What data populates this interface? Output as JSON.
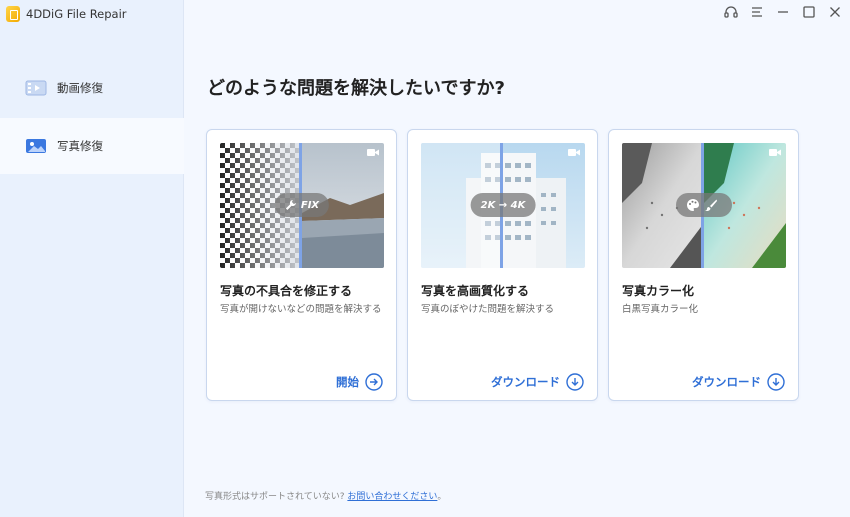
{
  "app": {
    "title": "4DDiG File Repair"
  },
  "sidebar": {
    "items": [
      {
        "label": "動画修復",
        "icon": "video-icon"
      },
      {
        "label": "写真修復",
        "icon": "image-icon",
        "active": true
      }
    ]
  },
  "window_controls": [
    "headset-icon",
    "menu-icon",
    "minimize-icon",
    "maximize-icon",
    "close-icon"
  ],
  "main": {
    "heading": "どのような問題を解決したいですか?",
    "cards": [
      {
        "title": "写真の不具合を修正する",
        "description": "写真が開けないなどの問題を解決する",
        "badge": "FIX",
        "action": "開始",
        "action_icon": "arrow-right-circle-icon"
      },
      {
        "title": "写真を高画質化する",
        "description": "写真のぼやけた問題を解決する",
        "badge": "2K → 4K",
        "action": "ダウンロード",
        "action_icon": "download-circle-icon"
      },
      {
        "title": "写真カラー化",
        "description": "白黒写真カラー化",
        "badge": "",
        "action": "ダウンロード",
        "action_icon": "download-circle-icon"
      }
    ]
  },
  "footer": {
    "text": "写真形式はサポートされていない?",
    "link": "お問い合わせください",
    "suffix": "。"
  },
  "colors": {
    "accent": "#2f6fd6",
    "sidebar_bg": "#e9f1fd",
    "main_bg": "#f4f8ff"
  }
}
